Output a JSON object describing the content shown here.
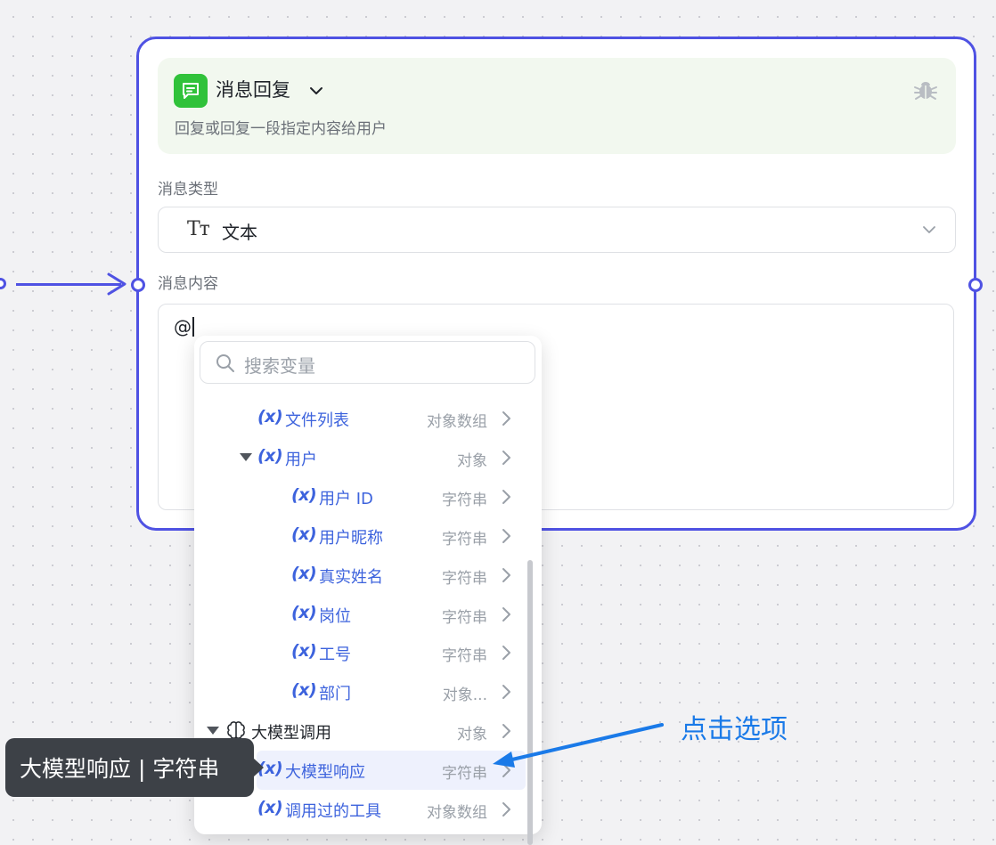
{
  "node": {
    "title": "消息回复",
    "description": "回复或回复一段指定内容给用户",
    "icon": "chat-bubble-icon",
    "accent_color": "#4f52e3",
    "icon_bg_color": "#30c23a"
  },
  "message_type": {
    "label": "消息类型",
    "value": "文本",
    "icon_text": "Tт"
  },
  "message_content": {
    "label": "消息内容",
    "value": "@"
  },
  "variable_picker": {
    "search_placeholder": "搜索变量",
    "var_icon_text": "(x)",
    "items": [
      {
        "label": "文件列表",
        "type": "对象数组"
      },
      {
        "label": "用户",
        "type": "对象"
      },
      {
        "label": "用户 ID",
        "type": "字符串"
      },
      {
        "label": "用户昵称",
        "type": "字符串"
      },
      {
        "label": "真实姓名",
        "type": "字符串"
      },
      {
        "label": "岗位",
        "type": "字符串"
      },
      {
        "label": "工号",
        "type": "字符串"
      },
      {
        "label": "部门",
        "type": "对象..."
      },
      {
        "label": "大模型调用",
        "type": "对象"
      },
      {
        "label": "大模型响应",
        "type": "字符串"
      },
      {
        "label": "调用过的工具",
        "type": "对象数组"
      }
    ]
  },
  "tooltip": {
    "text": "大模型响应 | 字符串"
  },
  "annotation": {
    "text": "点击选项",
    "color": "#1a7ae8"
  }
}
